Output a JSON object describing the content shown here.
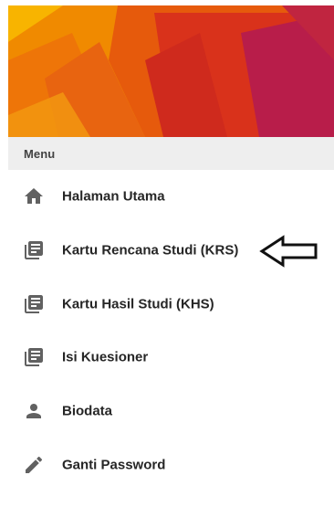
{
  "menu": {
    "subheader": "Menu",
    "items": [
      {
        "label": "Halaman Utama",
        "icon": "home-icon"
      },
      {
        "label": "Kartu Rencana Studi (KRS)",
        "icon": "library-books-icon"
      },
      {
        "label": "Kartu Hasil Studi (KHS)",
        "icon": "library-books-icon"
      },
      {
        "label": "Isi Kuesioner",
        "icon": "library-books-icon"
      },
      {
        "label": "Biodata",
        "icon": "person-icon"
      },
      {
        "label": "Ganti Password",
        "icon": "pencil-icon"
      }
    ]
  },
  "colors": {
    "header_yellow": "#f7a600",
    "header_orange": "#ef6c00",
    "header_red": "#d8261f",
    "header_magenta": "#b4145a",
    "icon_gray": "#616161",
    "subheader_bg": "#eeeeee"
  }
}
